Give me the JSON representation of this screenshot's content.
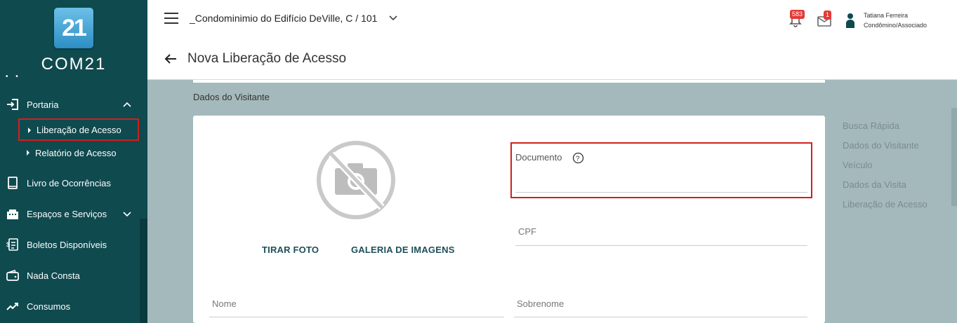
{
  "brand": {
    "logo_mark": "21",
    "logo_text": "COM21"
  },
  "sidebar": {
    "items": [
      {
        "label": "Portaria",
        "icon": "door-enter-icon"
      },
      {
        "label": "Livro de Ocorrências",
        "icon": "book-icon"
      },
      {
        "label": "Espaços e Serviços",
        "icon": "building-icon"
      },
      {
        "label": "Boletos Disponíveis",
        "icon": "invoice-icon"
      },
      {
        "label": "Nada Consta",
        "icon": "wallet-icon"
      },
      {
        "label": "Consumos",
        "icon": "trend-up-icon"
      }
    ],
    "subitems": [
      {
        "label": "Liberação de Acesso"
      },
      {
        "label": "Relatório de Acesso"
      }
    ]
  },
  "header": {
    "condo": "_Condominimio do Edifício DeVille, C / 101",
    "notifications_count": "583",
    "messages_count": "1",
    "user_name": "Tatiana Ferreira",
    "user_role": "Condômino/Associado"
  },
  "page": {
    "title": "Nova Liberação de Acesso",
    "section": "Dados do Visitante"
  },
  "form": {
    "take_photo": "TIRAR FOTO",
    "gallery": "GALERIA DE IMAGENS",
    "documento_label": "Documento",
    "cpf_label": "CPF",
    "nome_label": "Nome",
    "sobrenome_label": "Sobrenome"
  },
  "toc": [
    "Busca Rápida",
    "Dados do Visitante",
    "Veículo",
    "Dados da Visita",
    "Liberação de Acesso"
  ],
  "colors": {
    "sidebar": "#0f4a4f",
    "main_bg": "#a4b9bb",
    "highlight": "#d0201f",
    "badge": "#e53935"
  }
}
